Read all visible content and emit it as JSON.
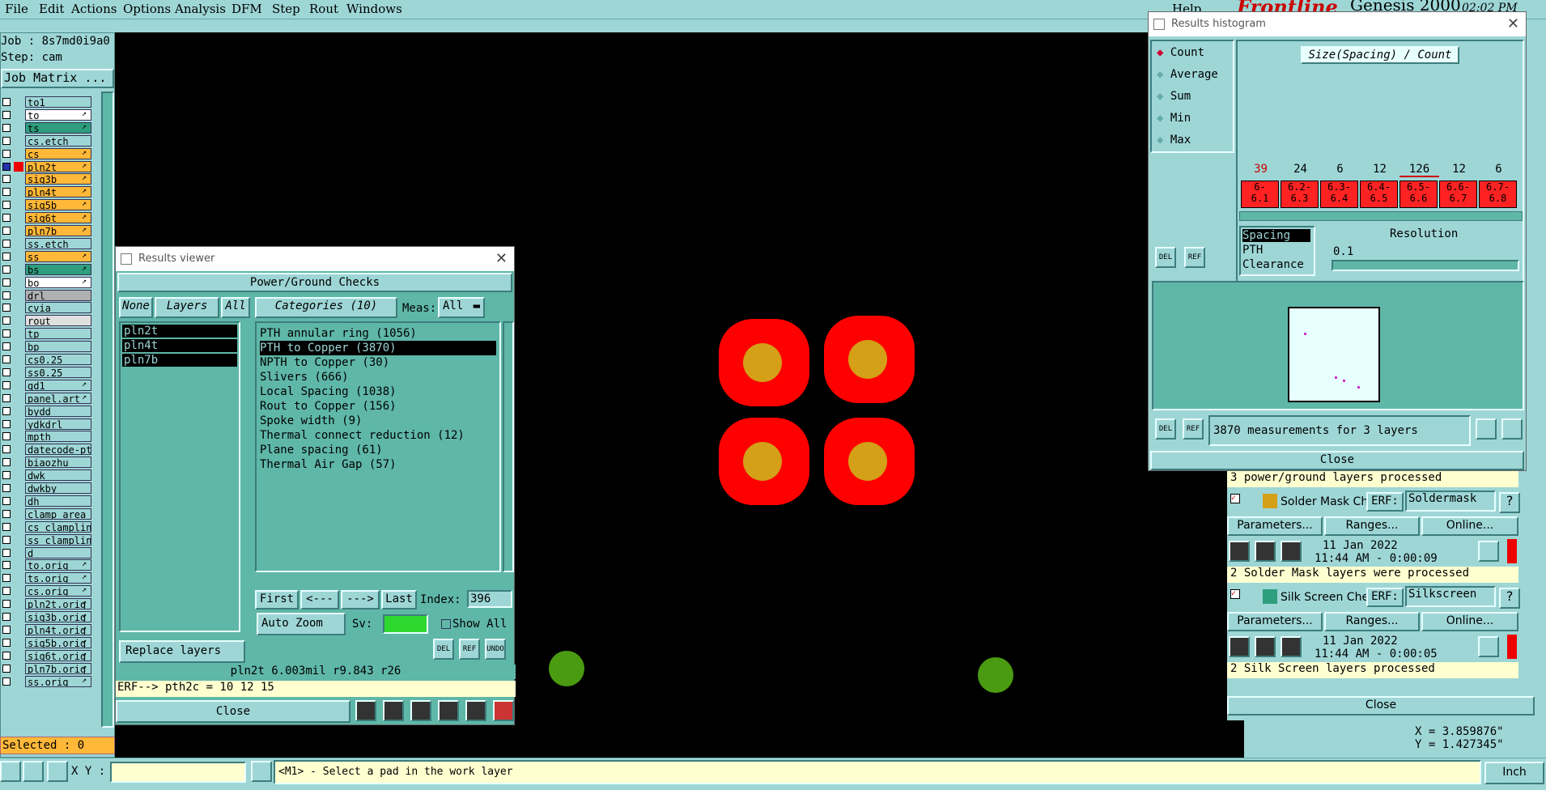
{
  "menu": [
    "File",
    "Edit",
    "Actions",
    "Options",
    "Analysis",
    "DFM",
    "Step",
    "Rout",
    "Windows"
  ],
  "help": "Help",
  "brand": {
    "logo": "Frontline",
    "product": "Genesis 2000",
    "time": "02:02 PM"
  },
  "job": {
    "job_label": "Job : 8s7md0i9a0",
    "step_label": "Step: cam",
    "matrix_button": "Job Matrix ..."
  },
  "layers": [
    {
      "name": "to1",
      "color": "#9ed6d6"
    },
    {
      "name": "to",
      "color": "#ffffff",
      "flag": "↗"
    },
    {
      "name": "ts",
      "color": "#2e9e7e",
      "flag": "↗"
    },
    {
      "name": "cs.etch",
      "color": "#9ed6d6"
    },
    {
      "name": "cs",
      "color": "#ffb838",
      "flag": "↗"
    },
    {
      "name": "pln2t",
      "color": "#ffb838",
      "flag": "↗",
      "active": true
    },
    {
      "name": "sig3b",
      "color": "#ffb838",
      "flag": "↗"
    },
    {
      "name": "pln4t",
      "color": "#ffb838",
      "flag": "↗"
    },
    {
      "name": "sig5b",
      "color": "#ffb838",
      "flag": "↗"
    },
    {
      "name": "sig6t",
      "color": "#ffb838",
      "flag": "↗"
    },
    {
      "name": "pln7b",
      "color": "#ffb838",
      "flag": "↗"
    },
    {
      "name": "ss.etch",
      "color": "#9ed6d6"
    },
    {
      "name": "ss",
      "color": "#ffb838",
      "flag": "↗"
    },
    {
      "name": "bs",
      "color": "#2e9e7e",
      "flag": "↗"
    },
    {
      "name": "bo",
      "color": "#ffffff",
      "flag": "↗"
    },
    {
      "name": "drl",
      "color": "#b0b0b0"
    },
    {
      "name": "cvia",
      "color": "#9ed6d6"
    },
    {
      "name": "rout",
      "color": "#e0e0e0"
    },
    {
      "name": "tp",
      "color": "#9ed6d6"
    },
    {
      "name": "bp",
      "color": "#9ed6d6"
    },
    {
      "name": "cs0.25",
      "color": "#9ed6d6"
    },
    {
      "name": "ss0.25",
      "color": "#9ed6d6"
    },
    {
      "name": "gd1",
      "color": "#9ed6d6",
      "flag": "↗"
    },
    {
      "name": "panel.art",
      "color": "#9ed6d6",
      "flag": "↗"
    },
    {
      "name": "bydd",
      "color": "#9ed6d6"
    },
    {
      "name": "ydkdrl",
      "color": "#9ed6d6"
    },
    {
      "name": "mpth",
      "color": "#9ed6d6"
    },
    {
      "name": "datecode-pte",
      "color": "#9ed6d6"
    },
    {
      "name": "biaozhu",
      "color": "#9ed6d6"
    },
    {
      "name": "dwk",
      "color": "#9ed6d6"
    },
    {
      "name": "dwkby",
      "color": "#9ed6d6"
    },
    {
      "name": "dh",
      "color": "#9ed6d6"
    },
    {
      "name": "clamp_area",
      "color": "#9ed6d6"
    },
    {
      "name": "cs_clampline",
      "color": "#9ed6d6"
    },
    {
      "name": "ss_clampline",
      "color": "#9ed6d6"
    },
    {
      "name": "d",
      "color": "#9ed6d6"
    },
    {
      "name": "to.orig",
      "color": "#9ed6d6",
      "flag": "↗"
    },
    {
      "name": "ts.orig",
      "color": "#9ed6d6",
      "flag": "↗"
    },
    {
      "name": "cs.orig",
      "color": "#9ed6d6",
      "flag": "↗"
    },
    {
      "name": "pln2t.orig",
      "color": "#9ed6d6",
      "flag": "↗"
    },
    {
      "name": "sig3b.orig",
      "color": "#9ed6d6",
      "flag": "↗"
    },
    {
      "name": "pln4t.orig",
      "color": "#9ed6d6",
      "flag": "↗"
    },
    {
      "name": "sig5b.orig",
      "color": "#9ed6d6",
      "flag": "↗"
    },
    {
      "name": "sig6t.orig",
      "color": "#9ed6d6",
      "flag": "↗"
    },
    {
      "name": "pln7b.orig",
      "color": "#9ed6d6",
      "flag": "↗"
    },
    {
      "name": "ss.orig",
      "color": "#9ed6d6",
      "flag": "↗"
    }
  ],
  "selected_label": "Selected : 0",
  "results_viewer": {
    "title": "Results viewer",
    "header": "Power/Ground Checks",
    "btn_none": "None",
    "btn_layers": "Layers",
    "btn_all": "All",
    "layers": [
      "pln2t",
      "pln4t",
      "pln7b"
    ],
    "categories_label": "Categories (10)",
    "meas_label": "Meas:",
    "meas_value": "All",
    "categories": [
      "PTH annular ring (1056)",
      "PTH to Copper (3870)",
      "NPTH to Copper (30)",
      "Slivers (666)",
      "Local Spacing (1038)",
      "Rout to Copper (156)",
      "Spoke width (9)",
      "Thermal connect reduction (12)",
      "Plane spacing (61)",
      "Thermal Air Gap (57)"
    ],
    "selected_category": 1,
    "nav_first": "First",
    "nav_prev": "<---",
    "nav_next": "--->",
    "nav_last": "Last",
    "index_label": "Index:",
    "index_value": "396",
    "auto_zoom": "Auto Zoom",
    "sv_label": "Sv:",
    "show_all": "Show All",
    "replace_layers": "Replace layers",
    "del": "DEL",
    "ref": "REF",
    "undo": "UNDO",
    "measure_line": "pln2t 6.003mil   r9.843  r26",
    "erf_line": "ERF--> pth2c = 10 12 15",
    "close": "Close"
  },
  "histogram": {
    "title": "Results histogram",
    "modes": [
      "Count",
      "Average",
      "Sum",
      "Min",
      "Max"
    ],
    "selected_mode": 0,
    "chart_title": "Size(Spacing) / Count",
    "del": "DEL",
    "ref": "REF",
    "measure_types": [
      "Spacing",
      "PTH",
      "Clearance"
    ],
    "resolution_label": "Resolution",
    "resolution_value": "0.1",
    "summary": "3870 measurements for 3 layers",
    "close": "Close"
  },
  "chart_data": {
    "type": "bar",
    "title": "Size(Spacing) / Count",
    "categories": [
      "6-6.1",
      "6.2-6.3",
      "6.3-6.4",
      "6.4-6.5",
      "6.5-6.6",
      "6.6-6.7",
      "6.7-6.8"
    ],
    "values": [
      39,
      24,
      6,
      12,
      126,
      12,
      6
    ],
    "counts": [
      "39",
      "24",
      "6",
      "12",
      "126",
      "12",
      "6"
    ],
    "bins": [
      [
        "6-",
        "6.1"
      ],
      [
        "6.2-",
        "6.3"
      ],
      [
        "6.3-",
        "6.4"
      ],
      [
        "6.4-",
        "6.5"
      ],
      [
        "6.5-",
        "6.6"
      ],
      [
        "6.6-",
        "6.7"
      ],
      [
        "6.7-",
        "6.8"
      ]
    ]
  },
  "checks": {
    "pg_status": "3 power/ground layers processed",
    "solder": {
      "name": "Solder Mask Ch",
      "erf": "ERF:",
      "erf_value": "Soldermask",
      "help": "?",
      "params": "Parameters...",
      "ranges": "Ranges...",
      "online": "Online...",
      "date": "11 Jan 2022",
      "time": "11:44 AM - 0:00:09",
      "status": "2 Solder Mask layers were processed"
    },
    "silk": {
      "name": "Silk Screen Che",
      "erf": "ERF:",
      "erf_value": "Silkscreen",
      "help": "?",
      "params": "Parameters...",
      "ranges": "Ranges...",
      "online": "Online...",
      "date": "11 Jan 2022",
      "time": "11:44 AM - 0:00:05",
      "status": "2 Silk Screen layers processed"
    },
    "close": "Close"
  },
  "coords": {
    "x": "X = 3.859876\"",
    "y": "Y = 1.427345\""
  },
  "bottom": {
    "xy_label": "X Y :",
    "prompt": "<M1> - Select a pad in the work layer",
    "units": "Inch"
  }
}
